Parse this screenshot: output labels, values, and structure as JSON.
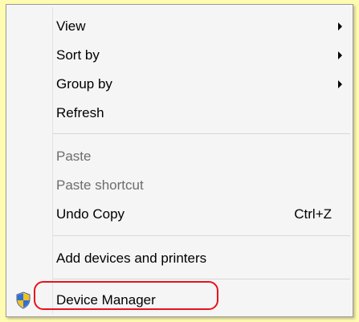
{
  "menu": {
    "items": [
      {
        "label": "View"
      },
      {
        "label": "Sort by"
      },
      {
        "label": "Group by"
      },
      {
        "label": "Refresh"
      },
      {
        "label": "Paste"
      },
      {
        "label": "Paste shortcut"
      },
      {
        "label": "Undo Copy",
        "shortcut": "Ctrl+Z"
      },
      {
        "label": "Add devices and printers"
      },
      {
        "label": "Device Manager",
        "icon": "shield-icon"
      }
    ]
  },
  "colors": {
    "background": "#fffbb0",
    "menu_background": "#f5f5f5",
    "highlight_outline": "#e8121c",
    "disabled_text": "#6d6d6d"
  }
}
